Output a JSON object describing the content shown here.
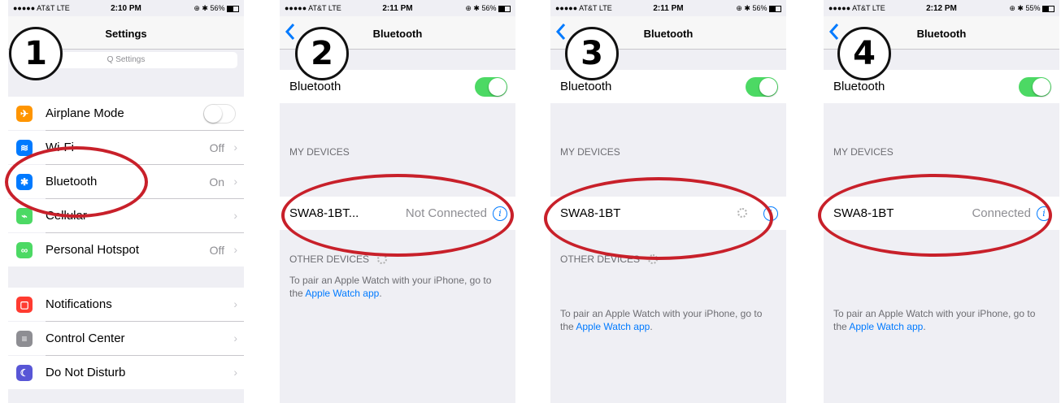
{
  "panels": [
    {
      "badge": "1",
      "status": {
        "carrier": "●●●●● AT&T  LTE",
        "time": "2:10 PM",
        "right": "⊕ ✱ 56%"
      },
      "nav_title": "Settings",
      "search_placeholder": "Q Settings",
      "rows": [
        {
          "label": "Airplane Mode",
          "value": "",
          "icon": "airplane-icon",
          "color": "#ff9500"
        },
        {
          "label": "Wi-Fi",
          "value": "Off",
          "icon": "wifi-icon",
          "color": "#007aff"
        },
        {
          "label": "Bluetooth",
          "value": "On",
          "icon": "bluetooth-icon",
          "color": "#007aff"
        },
        {
          "label": "Cellular",
          "value": "",
          "icon": "cellular-icon",
          "color": "#4cd964"
        },
        {
          "label": "Personal Hotspot",
          "value": "Off",
          "icon": "hotspot-icon",
          "color": "#4cd964"
        },
        {
          "label": "Notifications",
          "value": "",
          "icon": "notifications-icon",
          "color": "#ff3b30"
        },
        {
          "label": "Control Center",
          "value": "",
          "icon": "control-center-icon",
          "color": "#8e8e93"
        },
        {
          "label": "Do Not Disturb",
          "value": "",
          "icon": "moon-icon",
          "color": "#5856d6"
        }
      ]
    },
    {
      "badge": "2",
      "status": {
        "carrier": "●●●●● AT&T  LTE",
        "time": "2:11 PM",
        "right": "⊕ ✱ 56%"
      },
      "nav_title": "Bluetooth",
      "bt_label": "Bluetooth",
      "my_devices": "MY DEVICES",
      "device_name": "SWA8-1BT...",
      "device_status": "Not Connected",
      "other_devices": "OTHER DEVICES",
      "note_text": "To pair an Apple Watch with your iPhone, go to the ",
      "note_link": "Apple Watch app",
      "note_end": "."
    },
    {
      "badge": "3",
      "status": {
        "carrier": "●●●●● AT&T  LTE",
        "time": "2:11 PM",
        "right": "⊕ ✱ 56%"
      },
      "nav_title": "Bluetooth",
      "bt_label": "Bluetooth",
      "my_devices": "MY DEVICES",
      "device_name": "SWA8-1BT",
      "device_status": "",
      "other_devices": "OTHER DEVICES",
      "note_text": "To pair an Apple Watch with your iPhone, go to the ",
      "note_link": "Apple Watch app",
      "note_end": "."
    },
    {
      "badge": "4",
      "status": {
        "carrier": "●●●●● AT&T  LTE",
        "time": "2:12 PM",
        "right": "⊕ ✱ 55%"
      },
      "nav_title": "Bluetooth",
      "bt_label": "Bluetooth",
      "my_devices": "MY DEVICES",
      "device_name": "SWA8-1BT",
      "device_status": "Connected",
      "note_text": "To pair an Apple Watch with your iPhone, go to the ",
      "note_link": "Apple Watch app",
      "note_end": "."
    }
  ],
  "colors": {
    "toggle_on": "#4cd964",
    "link": "#007aff",
    "annotation": "#c8202a"
  }
}
